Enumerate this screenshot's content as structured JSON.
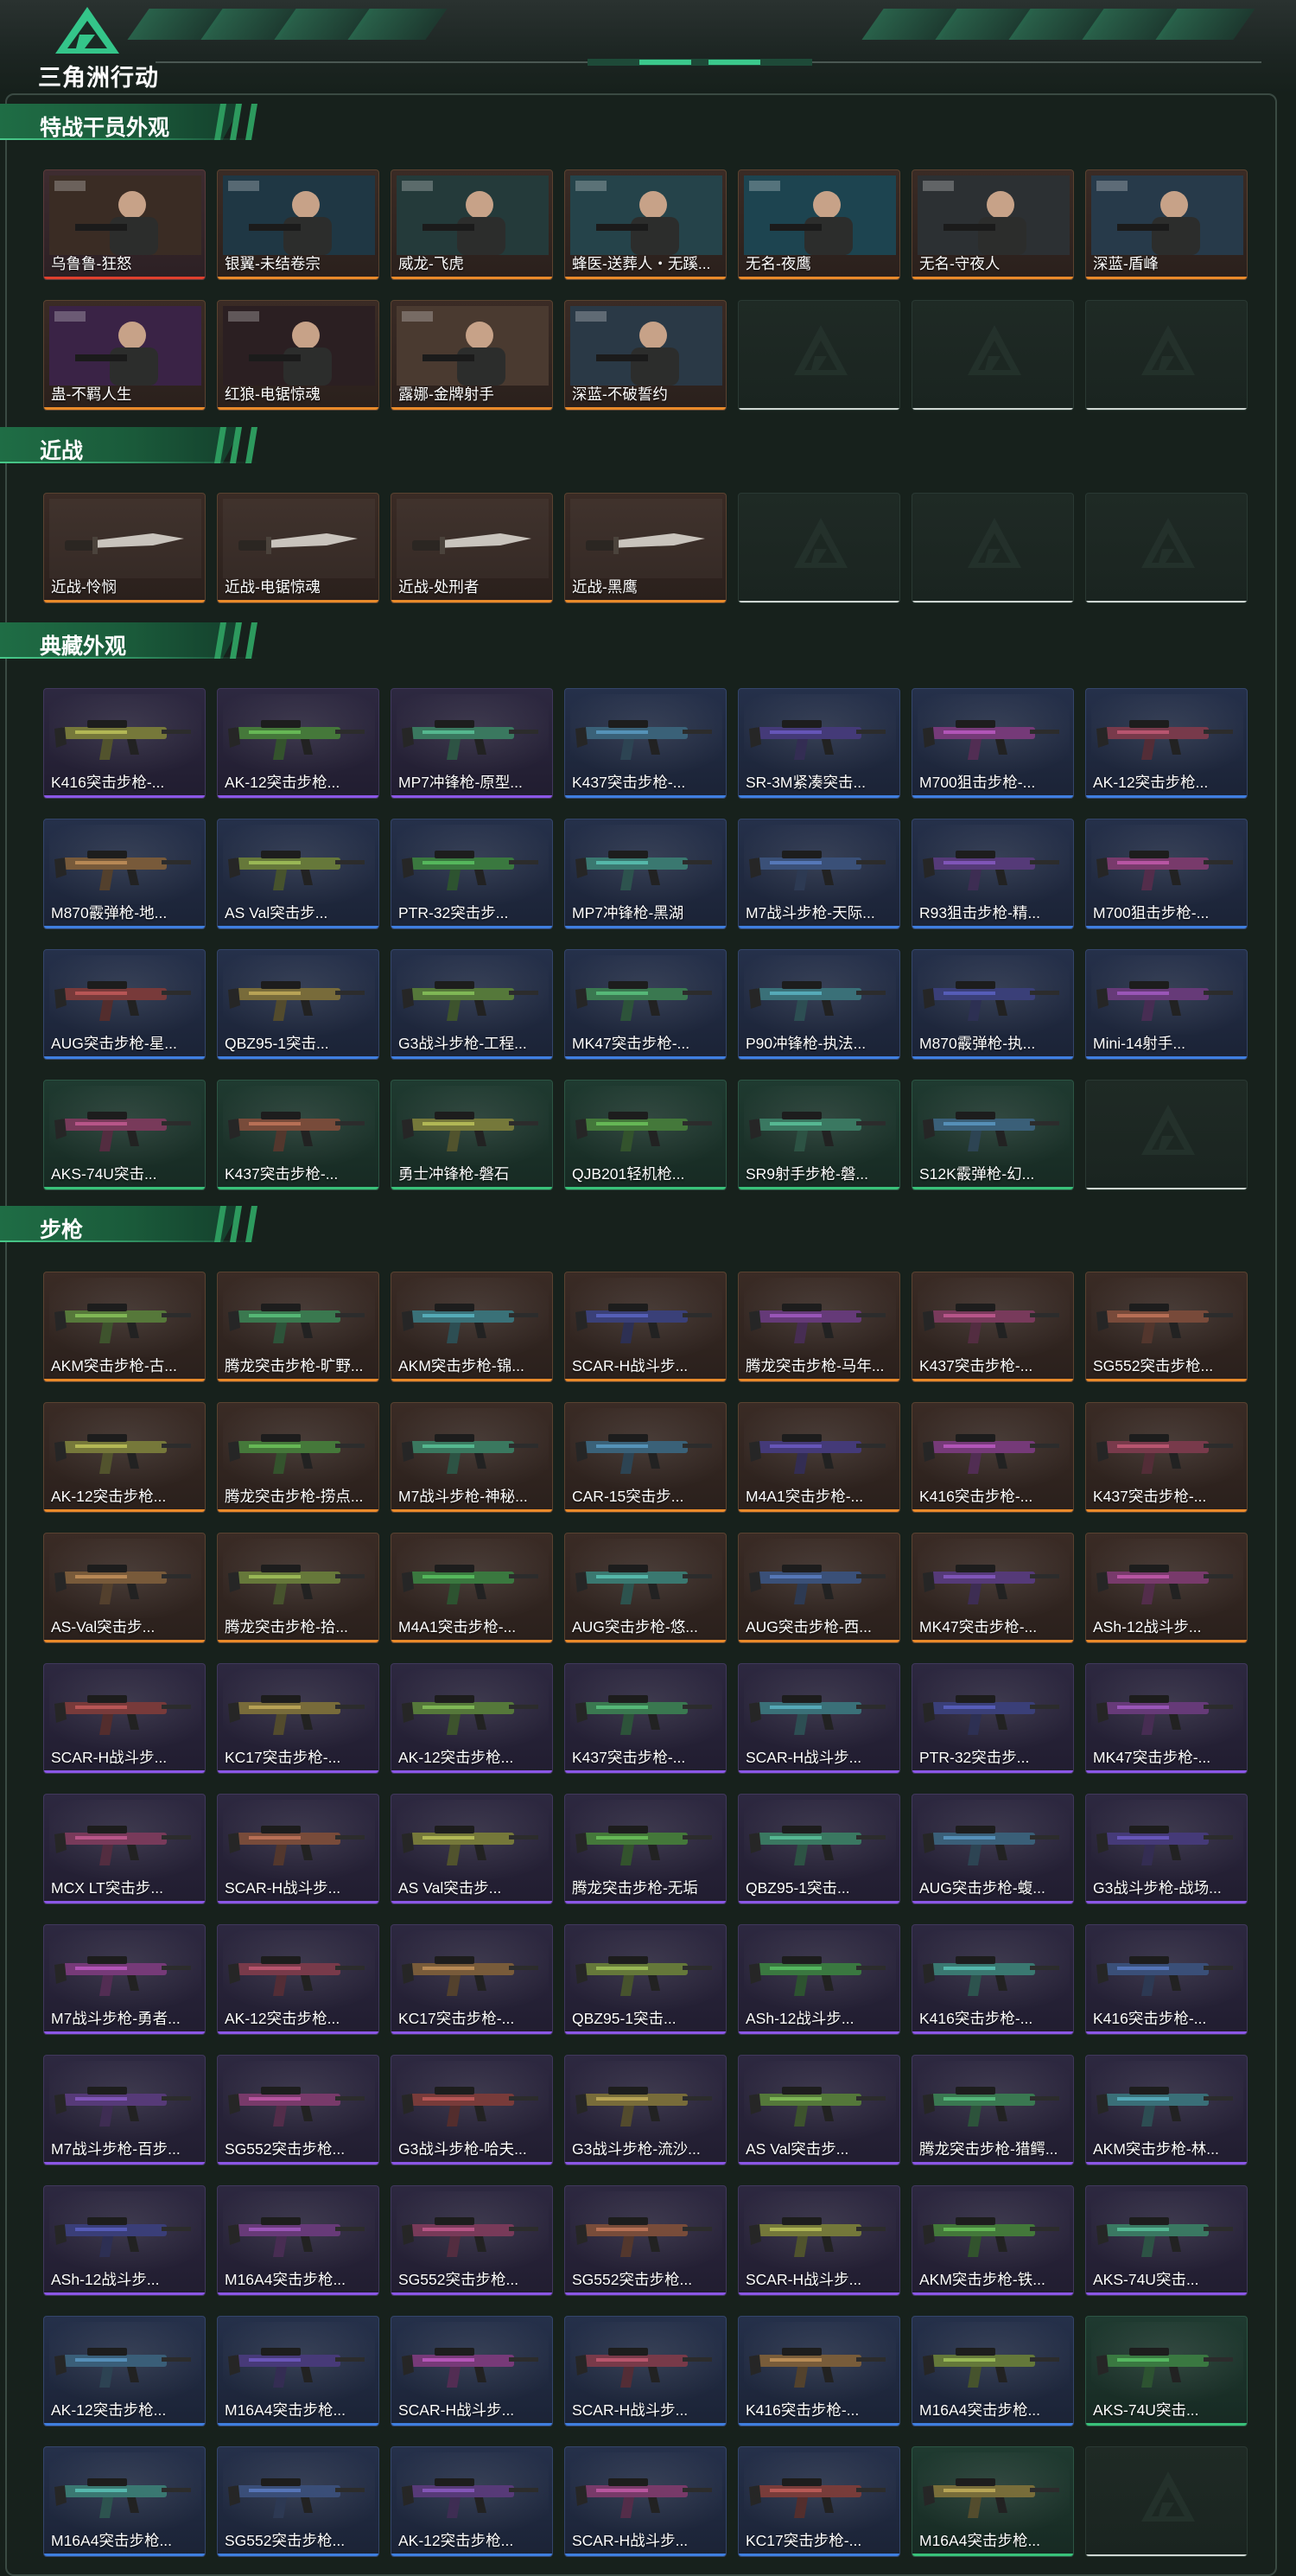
{
  "header": {
    "logo_text": "三角洲行动"
  },
  "colors": {
    "accent": "#2d9a5e",
    "rarity_red": "#e0402e",
    "rarity_orange": "#e98a2a",
    "rarity_purple": "#8b57e6",
    "rarity_blue": "#3f7fe0",
    "rarity_green": "#39c27a"
  },
  "sections": [
    {
      "title": "特战干员外观",
      "items": [
        {
          "label": "乌鲁鲁-狂怒",
          "rarity": "red",
          "thumb": "operator"
        },
        {
          "label": "银翼-未结卷宗",
          "rarity": "orange",
          "thumb": "operator"
        },
        {
          "label": "威龙-飞虎",
          "rarity": "orange",
          "thumb": "operator"
        },
        {
          "label": "蜂医-送葬人・无蹊...",
          "rarity": "orange",
          "thumb": "operator"
        },
        {
          "label": "无名-夜鹰",
          "rarity": "orange",
          "thumb": "operator"
        },
        {
          "label": "无名-守夜人",
          "rarity": "orange",
          "thumb": "operator"
        },
        {
          "label": "深蓝-盾峰",
          "rarity": "orange",
          "thumb": "operator"
        },
        {
          "label": "蛊-不羁人生",
          "rarity": "orange",
          "thumb": "operator"
        },
        {
          "label": "红狼-电锯惊魂",
          "rarity": "orange",
          "thumb": "operator"
        },
        {
          "label": "露娜-金牌射手",
          "rarity": "orange",
          "thumb": "operator"
        },
        {
          "label": "深蓝-不破誓约",
          "rarity": "orange",
          "thumb": "operator"
        },
        {
          "label": "",
          "rarity": "empty"
        },
        {
          "label": "",
          "rarity": "empty"
        },
        {
          "label": "",
          "rarity": "empty"
        }
      ]
    },
    {
      "title": "近战",
      "items": [
        {
          "label": "近战-怜悯",
          "rarity": "orange",
          "thumb": "knife"
        },
        {
          "label": "近战-电锯惊魂",
          "rarity": "orange",
          "thumb": "knife"
        },
        {
          "label": "近战-处刑者",
          "rarity": "orange",
          "thumb": "knife"
        },
        {
          "label": "近战-黑鹰",
          "rarity": "orange",
          "thumb": "knife"
        },
        {
          "label": "",
          "rarity": "empty"
        },
        {
          "label": "",
          "rarity": "empty"
        },
        {
          "label": "",
          "rarity": "empty"
        }
      ]
    },
    {
      "title": "典藏外观",
      "items": [
        {
          "label": "K416突击步枪-...",
          "rarity": "purple",
          "thumb": "gun"
        },
        {
          "label": "AK-12突击步枪...",
          "rarity": "purple",
          "thumb": "gun"
        },
        {
          "label": "MP7冲锋枪-原型...",
          "rarity": "purple",
          "thumb": "gun"
        },
        {
          "label": "K437突击步枪-...",
          "rarity": "blue",
          "thumb": "gun"
        },
        {
          "label": "SR-3M紧凑突击...",
          "rarity": "blue",
          "thumb": "gun"
        },
        {
          "label": "M700狙击步枪-...",
          "rarity": "blue",
          "thumb": "gun"
        },
        {
          "label": "AK-12突击步枪...",
          "rarity": "blue",
          "thumb": "gun"
        },
        {
          "label": "M870霰弹枪-地...",
          "rarity": "blue",
          "thumb": "gun"
        },
        {
          "label": "AS Val突击步...",
          "rarity": "blue",
          "thumb": "gun"
        },
        {
          "label": "PTR-32突击步...",
          "rarity": "blue",
          "thumb": "gun"
        },
        {
          "label": "MP7冲锋枪-黑湖",
          "rarity": "blue",
          "thumb": "gun"
        },
        {
          "label": "M7战斗步枪-天际...",
          "rarity": "blue",
          "thumb": "gun"
        },
        {
          "label": "R93狙击步枪-精...",
          "rarity": "blue",
          "thumb": "gun"
        },
        {
          "label": "M700狙击步枪-...",
          "rarity": "blue",
          "thumb": "gun"
        },
        {
          "label": "AUG突击步枪-星...",
          "rarity": "blue",
          "thumb": "gun"
        },
        {
          "label": "QBZ95-1突击...",
          "rarity": "blue",
          "thumb": "gun"
        },
        {
          "label": "G3战斗步枪-工程...",
          "rarity": "blue",
          "thumb": "gun"
        },
        {
          "label": "MK47突击步枪-...",
          "rarity": "blue",
          "thumb": "gun"
        },
        {
          "label": "P90冲锋枪-执法...",
          "rarity": "blue",
          "thumb": "gun"
        },
        {
          "label": "M870霰弹枪-执...",
          "rarity": "blue",
          "thumb": "gun"
        },
        {
          "label": "Mini-14射手...",
          "rarity": "blue",
          "thumb": "gun"
        },
        {
          "label": "AKS-74U突击...",
          "rarity": "green",
          "thumb": "gun"
        },
        {
          "label": "K437突击步枪-...",
          "rarity": "green",
          "thumb": "gun"
        },
        {
          "label": "勇士冲锋枪-磐石",
          "rarity": "green",
          "thumb": "gun"
        },
        {
          "label": "QJB201轻机枪...",
          "rarity": "green",
          "thumb": "gun"
        },
        {
          "label": "SR9射手步枪-磐...",
          "rarity": "green",
          "thumb": "gun"
        },
        {
          "label": "S12K霰弹枪-幻...",
          "rarity": "green",
          "thumb": "gun"
        },
        {
          "label": "",
          "rarity": "empty"
        }
      ]
    },
    {
      "title": "步枪",
      "items": [
        {
          "label": "AKM突击步枪-古...",
          "rarity": "orange",
          "thumb": "gun"
        },
        {
          "label": "腾龙突击步枪-旷野...",
          "rarity": "orange",
          "thumb": "gun"
        },
        {
          "label": "AKM突击步枪-锦...",
          "rarity": "orange",
          "thumb": "gun"
        },
        {
          "label": "SCAR-H战斗步...",
          "rarity": "orange",
          "thumb": "gun"
        },
        {
          "label": "腾龙突击步枪-马年...",
          "rarity": "orange",
          "thumb": "gun"
        },
        {
          "label": "K437突击步枪-...",
          "rarity": "orange",
          "thumb": "gun"
        },
        {
          "label": "SG552突击步枪...",
          "rarity": "orange",
          "thumb": "gun"
        },
        {
          "label": "AK-12突击步枪...",
          "rarity": "orange",
          "thumb": "gun"
        },
        {
          "label": "腾龙突击步枪-捞点...",
          "rarity": "orange",
          "thumb": "gun"
        },
        {
          "label": "M7战斗步枪-神秘...",
          "rarity": "orange",
          "thumb": "gun"
        },
        {
          "label": "CAR-15突击步...",
          "rarity": "orange",
          "thumb": "gun"
        },
        {
          "label": "M4A1突击步枪-...",
          "rarity": "orange",
          "thumb": "gun"
        },
        {
          "label": "K416突击步枪-...",
          "rarity": "orange",
          "thumb": "gun"
        },
        {
          "label": "K437突击步枪-...",
          "rarity": "orange",
          "thumb": "gun"
        },
        {
          "label": "AS-Val突击步...",
          "rarity": "orange",
          "thumb": "gun"
        },
        {
          "label": "腾龙突击步枪-拾...",
          "rarity": "orange",
          "thumb": "gun"
        },
        {
          "label": "M4A1突击步枪-...",
          "rarity": "orange",
          "thumb": "gun"
        },
        {
          "label": "AUG突击步枪-悠...",
          "rarity": "orange",
          "thumb": "gun"
        },
        {
          "label": "AUG突击步枪-西...",
          "rarity": "orange",
          "thumb": "gun"
        },
        {
          "label": "MK47突击步枪-...",
          "rarity": "orange",
          "thumb": "gun"
        },
        {
          "label": "ASh-12战斗步...",
          "rarity": "orange",
          "thumb": "gun"
        },
        {
          "label": "SCAR-H战斗步...",
          "rarity": "purple",
          "thumb": "gun"
        },
        {
          "label": "KC17突击步枪-...",
          "rarity": "purple",
          "thumb": "gun"
        },
        {
          "label": "AK-12突击步枪...",
          "rarity": "purple",
          "thumb": "gun"
        },
        {
          "label": "K437突击步枪-...",
          "rarity": "purple",
          "thumb": "gun"
        },
        {
          "label": "SCAR-H战斗步...",
          "rarity": "purple",
          "thumb": "gun"
        },
        {
          "label": "PTR-32突击步...",
          "rarity": "purple",
          "thumb": "gun"
        },
        {
          "label": "MK47突击步枪-...",
          "rarity": "purple",
          "thumb": "gun"
        },
        {
          "label": "MCX LT突击步...",
          "rarity": "purple",
          "thumb": "gun"
        },
        {
          "label": "SCAR-H战斗步...",
          "rarity": "purple",
          "thumb": "gun"
        },
        {
          "label": "AS Val突击步...",
          "rarity": "purple",
          "thumb": "gun"
        },
        {
          "label": "腾龙突击步枪-无垢",
          "rarity": "purple",
          "thumb": "gun"
        },
        {
          "label": "QBZ95-1突击...",
          "rarity": "purple",
          "thumb": "gun"
        },
        {
          "label": "AUG突击步枪-蝮...",
          "rarity": "purple",
          "thumb": "gun"
        },
        {
          "label": "G3战斗步枪-战场...",
          "rarity": "purple",
          "thumb": "gun"
        },
        {
          "label": "M7战斗步枪-勇者...",
          "rarity": "purple",
          "thumb": "gun"
        },
        {
          "label": "AK-12突击步枪...",
          "rarity": "purple",
          "thumb": "gun"
        },
        {
          "label": "KC17突击步枪-...",
          "rarity": "purple",
          "thumb": "gun"
        },
        {
          "label": "QBZ95-1突击...",
          "rarity": "purple",
          "thumb": "gun"
        },
        {
          "label": "ASh-12战斗步...",
          "rarity": "purple",
          "thumb": "gun"
        },
        {
          "label": "K416突击步枪-...",
          "rarity": "purple",
          "thumb": "gun"
        },
        {
          "label": "K416突击步枪-...",
          "rarity": "purple",
          "thumb": "gun"
        },
        {
          "label": "M7战斗步枪-百步...",
          "rarity": "purple",
          "thumb": "gun"
        },
        {
          "label": "SG552突击步枪...",
          "rarity": "purple",
          "thumb": "gun"
        },
        {
          "label": "G3战斗步枪-哈夫...",
          "rarity": "purple",
          "thumb": "gun"
        },
        {
          "label": "G3战斗步枪-流沙...",
          "rarity": "purple",
          "thumb": "gun"
        },
        {
          "label": "AS Val突击步...",
          "rarity": "purple",
          "thumb": "gun"
        },
        {
          "label": "腾龙突击步枪-猎鳄...",
          "rarity": "purple",
          "thumb": "gun"
        },
        {
          "label": "AKM突击步枪-林...",
          "rarity": "purple",
          "thumb": "gun"
        },
        {
          "label": "ASh-12战斗步...",
          "rarity": "purple",
          "thumb": "gun"
        },
        {
          "label": "M16A4突击步枪...",
          "rarity": "purple",
          "thumb": "gun"
        },
        {
          "label": "SG552突击步枪...",
          "rarity": "purple",
          "thumb": "gun"
        },
        {
          "label": "SG552突击步枪...",
          "rarity": "purple",
          "thumb": "gun"
        },
        {
          "label": "SCAR-H战斗步...",
          "rarity": "purple",
          "thumb": "gun"
        },
        {
          "label": "AKM突击步枪-铁...",
          "rarity": "purple",
          "thumb": "gun"
        },
        {
          "label": "AKS-74U突击...",
          "rarity": "purple",
          "thumb": "gun"
        },
        {
          "label": "AK-12突击步枪...",
          "rarity": "blue",
          "thumb": "gun"
        },
        {
          "label": "M16A4突击步枪...",
          "rarity": "blue",
          "thumb": "gun"
        },
        {
          "label": "SCAR-H战斗步...",
          "rarity": "blue",
          "thumb": "gun"
        },
        {
          "label": "SCAR-H战斗步...",
          "rarity": "blue",
          "thumb": "gun"
        },
        {
          "label": "K416突击步枪-...",
          "rarity": "blue",
          "thumb": "gun"
        },
        {
          "label": "M16A4突击步枪...",
          "rarity": "blue",
          "thumb": "gun"
        },
        {
          "label": "AKS-74U突击...",
          "rarity": "green",
          "thumb": "gun"
        },
        {
          "label": "M16A4突击步枪...",
          "rarity": "blue",
          "thumb": "gun"
        },
        {
          "label": "SG552突击步枪...",
          "rarity": "blue",
          "thumb": "gun"
        },
        {
          "label": "AK-12突击步枪...",
          "rarity": "blue",
          "thumb": "gun"
        },
        {
          "label": "SCAR-H战斗步...",
          "rarity": "blue",
          "thumb": "gun"
        },
        {
          "label": "KC17突击步枪-...",
          "rarity": "blue",
          "thumb": "gun"
        },
        {
          "label": "M16A4突击步枪...",
          "rarity": "green",
          "thumb": "gun"
        },
        {
          "label": "",
          "rarity": "empty"
        }
      ]
    }
  ]
}
